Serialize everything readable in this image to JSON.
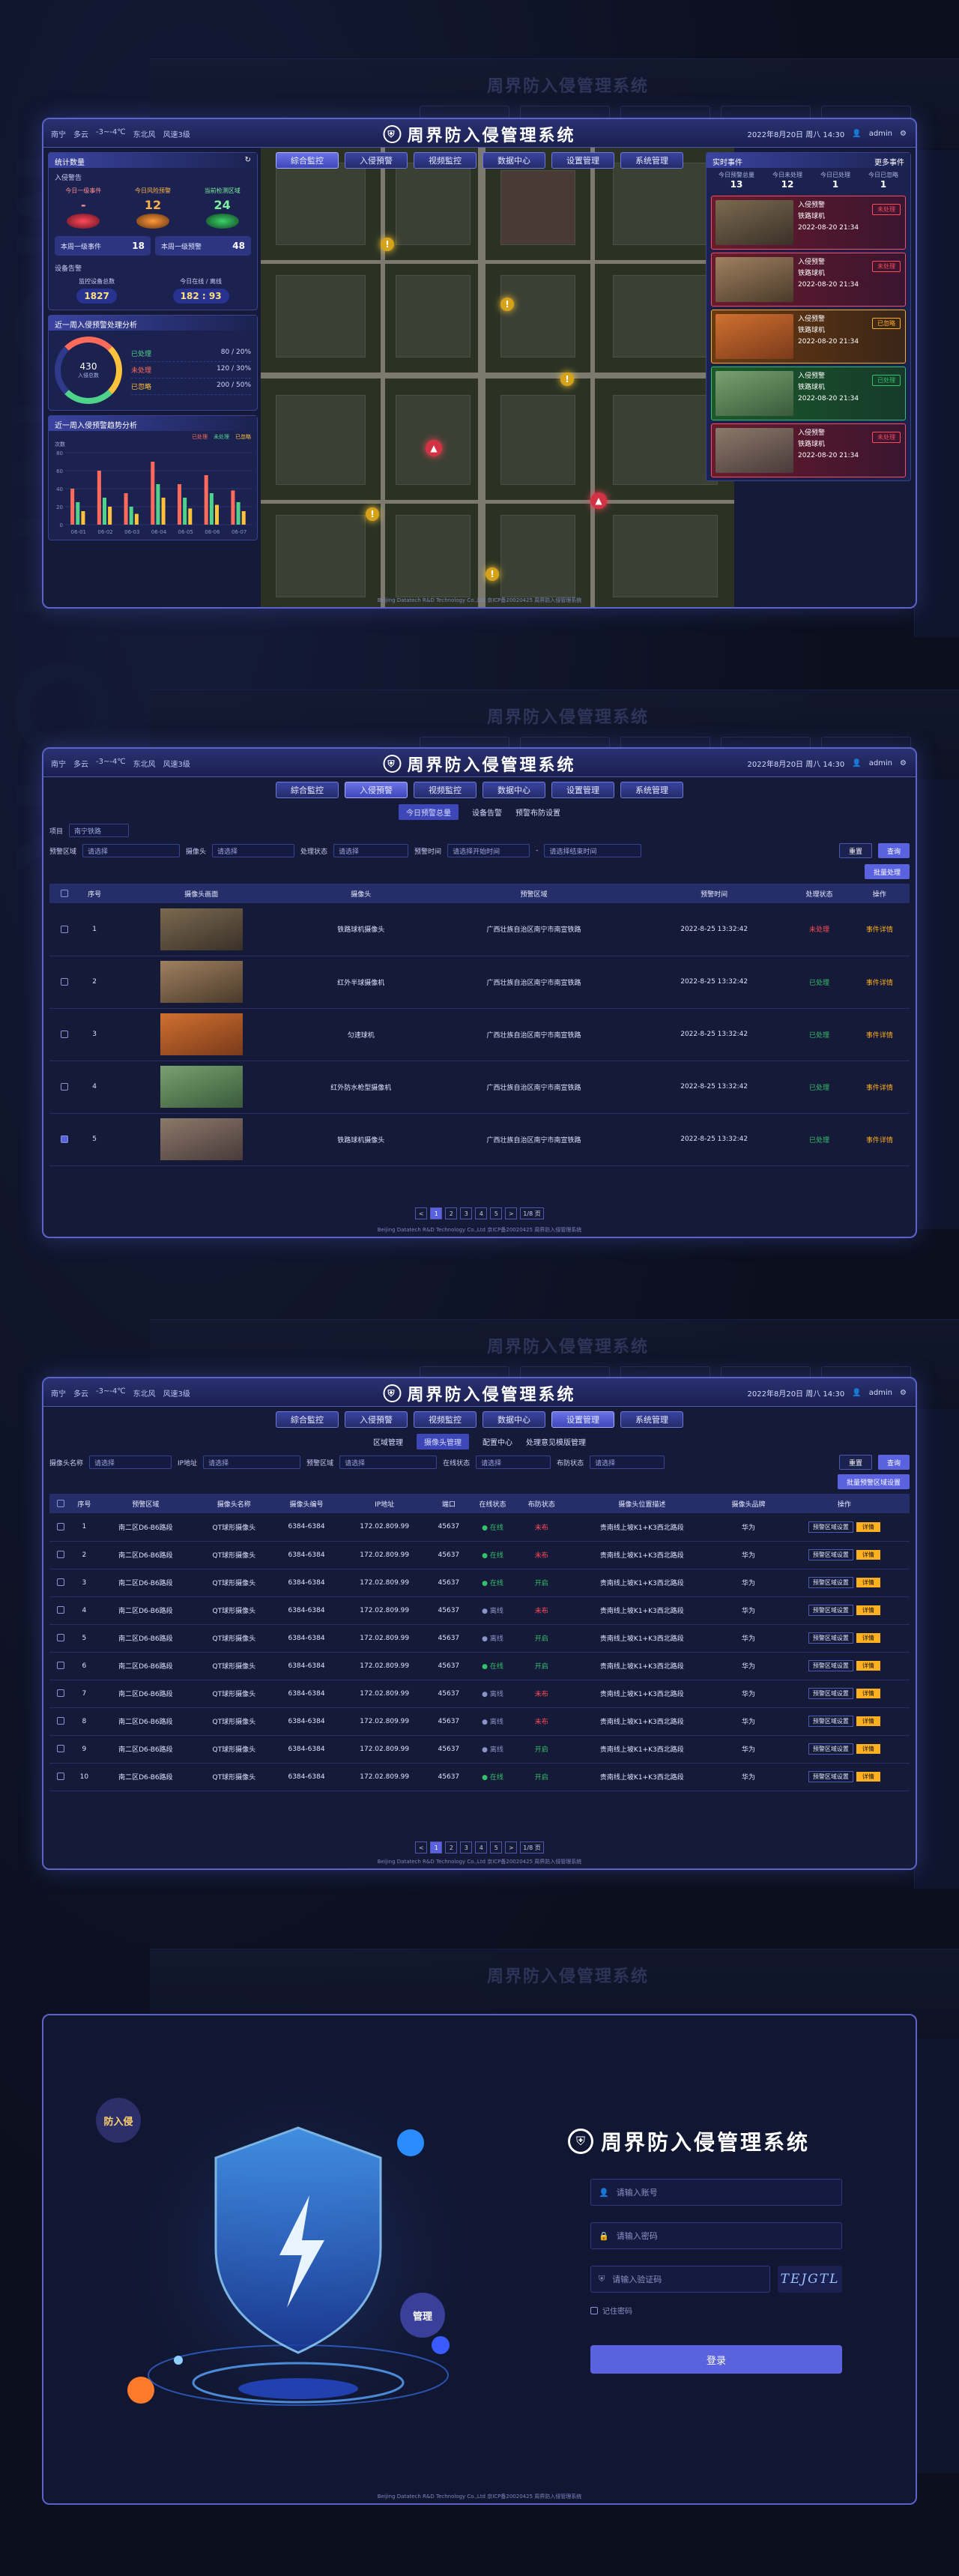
{
  "brand": {
    "title": "周界防入侵管理系统",
    "accent": "#5b63c9",
    "danger": "#d23344",
    "success": "#35c06b",
    "warning": "#ffb020"
  },
  "topbar": {
    "city": "南宁",
    "weather": "多云",
    "temp": "-3~-4℃",
    "link1": "东北风",
    "link2": "风速3级",
    "datetime": "2022年8月20日 周八 14:30",
    "user": "admin"
  },
  "nav": [
    "綜合監控",
    "入侵預警",
    "视频監控",
    "数据中心",
    "设置管理",
    "系统管理"
  ],
  "footer": "Beijing Datatech R&D Technology Co.,Ltd  京ICP备20020425  周界防入侵管理系统",
  "dashboard": {
    "stats_title": "统计数量",
    "alarm_title": "入侵警告",
    "alarm_today": {
      "label": "今日一级事件",
      "value": "-"
    },
    "alarm_risk": {
      "label": "今日风险预警",
      "value": "12"
    },
    "alarm_area": {
      "label": "当前检测区域",
      "value": "24"
    },
    "week1": {
      "label": "本周一级事件",
      "value": "18"
    },
    "week2": {
      "label": "本周一级预警",
      "value": "48"
    },
    "device_title": "设备告警",
    "device_a": {
      "label": "监控设备总数",
      "value": "1827"
    },
    "device_b": {
      "label": "今日在线 / 离线",
      "value": "182 : 93"
    },
    "ring_title": "近一周入侵预警处理分析",
    "ring_center": "430",
    "ring_center_label": "入侵总数",
    "ring_items": [
      {
        "label": "已处理",
        "value": "80 / 20%"
      },
      {
        "label": "未处理",
        "value": "120 / 30%"
      },
      {
        "label": "已忽略",
        "value": "200 / 50%"
      }
    ],
    "trend_title": "近一周入侵预警趋势分析",
    "trend_legend": [
      "已处理",
      "未处理",
      "已忽略"
    ],
    "trend_unit": "次数",
    "realtime_title": "实时事件",
    "realtime_more": "更多事件",
    "today_alarm_title": "今日预警总量",
    "stats": [
      {
        "label": "今日预警总量",
        "value": "13"
      },
      {
        "label": "今日未处理",
        "value": "12"
      },
      {
        "label": "今日已处理",
        "value": "1"
      },
      {
        "label": "今日已忽略",
        "value": "1"
      }
    ],
    "events": [
      {
        "title": "入侵预警",
        "device": "铁路球机",
        "time": "2022-08-20  21:34",
        "badge": "未处理",
        "tone": "red"
      },
      {
        "title": "入侵预警",
        "device": "铁路球机",
        "time": "2022-08-20  21:34",
        "badge": "未处理",
        "tone": "red"
      },
      {
        "title": "入侵预警",
        "device": "铁路球机",
        "time": "2022-08-20  21:34",
        "badge": "已忽略",
        "tone": "orange"
      },
      {
        "title": "入侵预警",
        "device": "铁路球机",
        "time": "2022-08-20  21:34",
        "badge": "已处理",
        "tone": "green"
      },
      {
        "title": "入侵预警",
        "device": "铁路球机",
        "time": "2022-08-20  21:34",
        "badge": "未处理",
        "tone": "red"
      }
    ]
  },
  "chart_data": {
    "type": "bar",
    "categories": [
      "06-01",
      "06-02",
      "06-03",
      "06-04",
      "06-05",
      "06-06",
      "06-07"
    ],
    "series": [
      {
        "name": "已处理",
        "values": [
          40,
          60,
          35,
          70,
          45,
          55,
          38
        ]
      },
      {
        "name": "未处理",
        "values": [
          25,
          30,
          20,
          45,
          30,
          35,
          25
        ]
      },
      {
        "name": "已忽略",
        "values": [
          15,
          20,
          12,
          30,
          18,
          22,
          15
        ]
      }
    ],
    "ylabel": "次数",
    "ylim": [
      0,
      80
    ]
  },
  "alerts": {
    "subtabs": [
      "今日预警总量",
      "设备告警",
      "预警布防设置"
    ],
    "f_project": "项目",
    "f_project_val": "南宁铁路",
    "f_area": "预警区域",
    "f_area_val": "请选择",
    "f_cam": "摄像头",
    "f_cam_val": "请选择",
    "f_status": "处理状态",
    "f_status_val": "请选择",
    "f_time": "预警时间",
    "f_time_start": "请选择开始时间",
    "f_time_end": "请选择结束时间",
    "btn_reset": "重置",
    "btn_query": "查询",
    "btn_batch": "批量处理",
    "cols": [
      "序号",
      "摄像头画面",
      "摄像头",
      "预警区域",
      "预警时间",
      "处理状态",
      "操作"
    ],
    "rows": [
      {
        "no": "1",
        "cam": "铁路球机摄像头",
        "area": "广西壮族自治区南宁市南宣铁路",
        "time": "2022-8-25  13:32:42",
        "status": "未处理",
        "tone": "red",
        "op": "事件详情"
      },
      {
        "no": "2",
        "cam": "红外半球摄像机",
        "area": "广西壮族自治区南宁市南宣铁路",
        "time": "2022-8-25  13:32:42",
        "status": "已处理",
        "tone": "green",
        "op": "事件详情"
      },
      {
        "no": "3",
        "cam": "匀速球机",
        "area": "广西壮族自治区南宁市南宣铁路",
        "time": "2022-8-25  13:32:42",
        "status": "已处理",
        "tone": "green",
        "op": "事件详情"
      },
      {
        "no": "4",
        "cam": "红外防水枪型摄像机",
        "area": "广西壮族自治区南宁市南宣铁路",
        "time": "2022-8-25  13:32:42",
        "status": "已处理",
        "tone": "green",
        "op": "事件详情"
      },
      {
        "no": "5",
        "cam": "铁路球机摄像头",
        "area": "广西壮族自治区南宁市南宣铁路",
        "time": "2022-8-25  13:32:42",
        "status": "已处理",
        "tone": "green",
        "op": "事件详情"
      }
    ],
    "pages": [
      "<",
      "1",
      "2",
      "3",
      "4",
      "5",
      ">",
      "1/8 页"
    ]
  },
  "devices": {
    "subtabs": [
      "区域管理",
      "摄像头管理",
      "配置中心",
      "处理意见模版管理"
    ],
    "f_cam": "摄像头名称",
    "f_cam_val": "请选择",
    "f_ip": "IP地址",
    "f_ip_val": "请选择",
    "f_area": "预警区域",
    "f_area_val": "请选择",
    "f_online": "在线状态",
    "f_online_val": "请选择",
    "f_arm": "布防状态",
    "f_arm_val": "请选择",
    "btn_reset": "重置",
    "btn_query": "查询",
    "btn_batch": "批量预警区域设置",
    "cols": [
      "序号",
      "预警区域",
      "摄像头名称",
      "摄像头编号",
      "IP地址",
      "端口",
      "在线状态",
      "布防状态",
      "摄像头位置描述",
      "摄像头品牌",
      "操作"
    ],
    "rows": [
      {
        "no": "1",
        "area": "南二区D6-B6路段",
        "name": "QT球形摄像头",
        "code": "6384-6384",
        "ip": "172.02.809.99",
        "port": "45637",
        "online": "在线",
        "otone": "green",
        "arm": "未布",
        "atone": "red",
        "pos": "贵南线上坡K1+K3西北路段",
        "brand": "华为"
      },
      {
        "no": "2",
        "area": "南二区D6-B6路段",
        "name": "QT球形摄像头",
        "code": "6384-6384",
        "ip": "172.02.809.99",
        "port": "45637",
        "online": "在线",
        "otone": "green",
        "arm": "未布",
        "atone": "red",
        "pos": "贵南线上坡K1+K3西北路段",
        "brand": "华为"
      },
      {
        "no": "3",
        "area": "南二区D6-B6路段",
        "name": "QT球形摄像头",
        "code": "6384-6384",
        "ip": "172.02.809.99",
        "port": "45637",
        "online": "在线",
        "otone": "green",
        "arm": "开启",
        "atone": "green",
        "pos": "贵南线上坡K1+K3西北路段",
        "brand": "华为"
      },
      {
        "no": "4",
        "area": "南二区D6-B6路段",
        "name": "QT球形摄像头",
        "code": "6384-6384",
        "ip": "172.02.809.99",
        "port": "45637",
        "online": "离线",
        "otone": "gray",
        "arm": "未布",
        "atone": "red",
        "pos": "贵南线上坡K1+K3西北路段",
        "brand": "华为"
      },
      {
        "no": "5",
        "area": "南二区D6-B6路段",
        "name": "QT球形摄像头",
        "code": "6384-6384",
        "ip": "172.02.809.99",
        "port": "45637",
        "online": "离线",
        "otone": "gray",
        "arm": "开启",
        "atone": "green",
        "pos": "贵南线上坡K1+K3西北路段",
        "brand": "华为"
      },
      {
        "no": "6",
        "area": "南二区D6-B6路段",
        "name": "QT球形摄像头",
        "code": "6384-6384",
        "ip": "172.02.809.99",
        "port": "45637",
        "online": "在线",
        "otone": "green",
        "arm": "开启",
        "atone": "green",
        "pos": "贵南线上坡K1+K3西北路段",
        "brand": "华为"
      },
      {
        "no": "7",
        "area": "南二区D6-B6路段",
        "name": "QT球形摄像头",
        "code": "6384-6384",
        "ip": "172.02.809.99",
        "port": "45637",
        "online": "离线",
        "otone": "gray",
        "arm": "未布",
        "atone": "red",
        "pos": "贵南线上坡K1+K3西北路段",
        "brand": "华为"
      },
      {
        "no": "8",
        "area": "南二区D6-B6路段",
        "name": "QT球形摄像头",
        "code": "6384-6384",
        "ip": "172.02.809.99",
        "port": "45637",
        "online": "离线",
        "otone": "gray",
        "arm": "未布",
        "atone": "red",
        "pos": "贵南线上坡K1+K3西北路段",
        "brand": "华为"
      },
      {
        "no": "9",
        "area": "南二区D6-B6路段",
        "name": "QT球形摄像头",
        "code": "6384-6384",
        "ip": "172.02.809.99",
        "port": "45637",
        "online": "离线",
        "otone": "gray",
        "arm": "开启",
        "atone": "green",
        "pos": "贵南线上坡K1+K3西北路段",
        "brand": "华为"
      },
      {
        "no": "10",
        "area": "南二区D6-B6路段",
        "name": "QT球形摄像头",
        "code": "6384-6384",
        "ip": "172.02.809.99",
        "port": "45637",
        "online": "在线",
        "otone": "green",
        "arm": "开启",
        "atone": "green",
        "pos": "贵南线上坡K1+K3西北路段",
        "brand": "华为"
      }
    ],
    "op_set": "预警区域设置",
    "op_detail": "详情",
    "pages": [
      "<",
      "1",
      "2",
      "3",
      "4",
      "5",
      ">",
      "1/8 页"
    ]
  },
  "login": {
    "title": "周界防入侵管理系统",
    "user_ph": "请输入账号",
    "pwd_ph": "请输入密码",
    "code_ph": "请输入验证码",
    "captcha": "TEJGTL",
    "remember": "记住密码",
    "submit": "登录",
    "badge1": "防入侵",
    "badge2": "管理"
  }
}
